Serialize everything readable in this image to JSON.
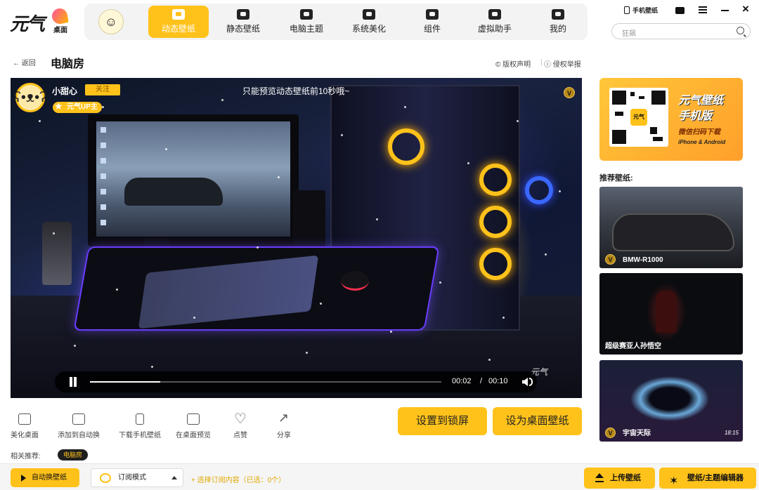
{
  "app": {
    "logo_text": "元气",
    "logo_sub": "桌面"
  },
  "nav": {
    "items": [
      {
        "label": "动态壁纸",
        "active": true
      },
      {
        "label": "静态壁纸"
      },
      {
        "label": "电脑主题"
      },
      {
        "label": "系统美化"
      },
      {
        "label": "组件"
      },
      {
        "label": "虚拟助手"
      },
      {
        "label": "我的"
      }
    ]
  },
  "header": {
    "phone_label": "手机壁纸",
    "search_placeholder": "狂飙"
  },
  "page": {
    "back_label": "返回",
    "title": "电脑房",
    "copyright": "版权声明",
    "report": "侵权举报"
  },
  "video": {
    "user": "小甜心",
    "follow": "关注",
    "up_badge": "元气UP主",
    "tip": "只能预览动态壁纸前10秒哦~",
    "badge": "V",
    "time_current": "00:02",
    "time_sep": "/",
    "time_total": "00:10",
    "progress": 0.2,
    "watermark": "元气"
  },
  "actions": [
    {
      "label": "美化桌面"
    },
    {
      "label": "添加到自动换"
    },
    {
      "label": "下载手机壁纸"
    },
    {
      "label": "在桌面预览"
    },
    {
      "label": "点赞"
    },
    {
      "label": "分享"
    }
  ],
  "buttons": {
    "lock": "设置到锁屏",
    "desktop": "设为桌面壁纸"
  },
  "related": {
    "label": "相关推荐:",
    "tag": "电脑房"
  },
  "promo": {
    "line1": "元气壁纸",
    "line2": "手机版",
    "line3": "微信扫码下载",
    "line4": "iPhone & Android",
    "qr_center": "元气"
  },
  "recommended": {
    "label": "推荐壁纸:",
    "items": [
      {
        "title": "BMW-R1000",
        "badge": "V"
      },
      {
        "title": "超级赛亚人孙悟空"
      },
      {
        "title": "宇宙天际",
        "badge": "V",
        "clock": "18:15"
      }
    ]
  },
  "bottom": {
    "auto_switch": "自动换壁纸",
    "subscribe_mode": "订阅模式",
    "choose_sub": "+ 选择订阅内容（已选：0个）",
    "upload": "上传壁纸",
    "editor": "壁纸/主题编辑器"
  },
  "colors": {
    "accent": "#ffc21a",
    "link": "#e0a800"
  }
}
